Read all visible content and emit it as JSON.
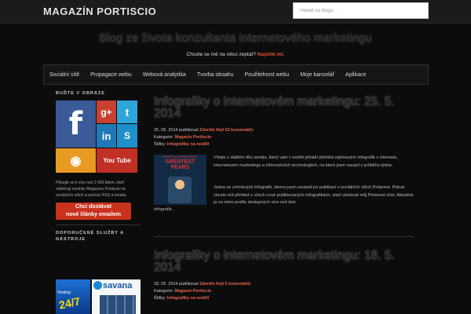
{
  "header": {
    "site_title": "Magazín Portiscio",
    "search_placeholder": "Hledat na blogu..."
  },
  "tagline": "Blog ze života konzultanta internetového marketingu",
  "subtagline": {
    "question": "Chcete se mě na něco zeptat?",
    "link": "Napište mi."
  },
  "nav": {
    "items": [
      "Sociální sítě",
      "Propagace webu",
      "Webová analytika",
      "Tvorba obsahu",
      "Použitelnost webu",
      "Moje kancelář",
      "Aplikace"
    ]
  },
  "sidebar": {
    "heading": "Buďte v obraze",
    "tiles": {
      "facebook": "f",
      "googleplus": "g+",
      "twitter": "t",
      "linkedin": "in",
      "rss": "◉",
      "youtube": "You Tube",
      "skype": "S"
    },
    "text": "Připojte se k více než 2 600 lidem, kteří odebírají novinky Magazínu Portiscio na sociálních sítích a pomocí RSS a emailu.",
    "button_line1": "Chci dostávat",
    "button_line2": "nové články emailem",
    "heading2": "Doporučené služby a nástroje",
    "banner_left_small": "Hosting",
    "banner_left_big": "24/7",
    "banner_right": "savana"
  },
  "posts": [
    {
      "title": "Infografiky o internetovém marketingu: 25. 5. 2014",
      "date": "25. 05. 2014",
      "published_by": "publikoval",
      "author": "Zdeněk Hejl",
      "comments": "32 komentářů",
      "category_label": "Kategorie:",
      "category": "Magazín Portiscio",
      "tags_label": "Štítky:",
      "tags": "Infografiky na neděli",
      "thumb_sub": "SEARCH MARKETERS'",
      "thumb_title": "GREATEST FEARS",
      "para1": "Vítejte u dalšího dílu seriálu, který vám v neděli přináší přehled zajímavých infografik o internetu, internetovém marketingu a informačních technologiích, na které jsem narazil v průběhu týdne.",
      "para2": "Jedna ze zmíněných infografik, kterou jsem sestavil po publikaci v sociálních sítích Pinterest. Pokud chcete mít přehled o všech nově publikovaných infografikách, stačí sledovat můj Pinterest účet. Aktuálně ja na mém profilu dostupných více než tisíc",
      "para3": "infografik."
    },
    {
      "title": "Infografiky o internetovém marketingu: 18. 5. 2014",
      "date": "18. 05. 2014",
      "published_by": "publikoval",
      "author": "Zdeněk Hejl",
      "comments": "5 komentářů",
      "category_label": "Kategorie:",
      "category": "Magazín Portiscio",
      "tags_label": "Štítky:",
      "tags": "Infografiky na neděli"
    }
  ]
}
